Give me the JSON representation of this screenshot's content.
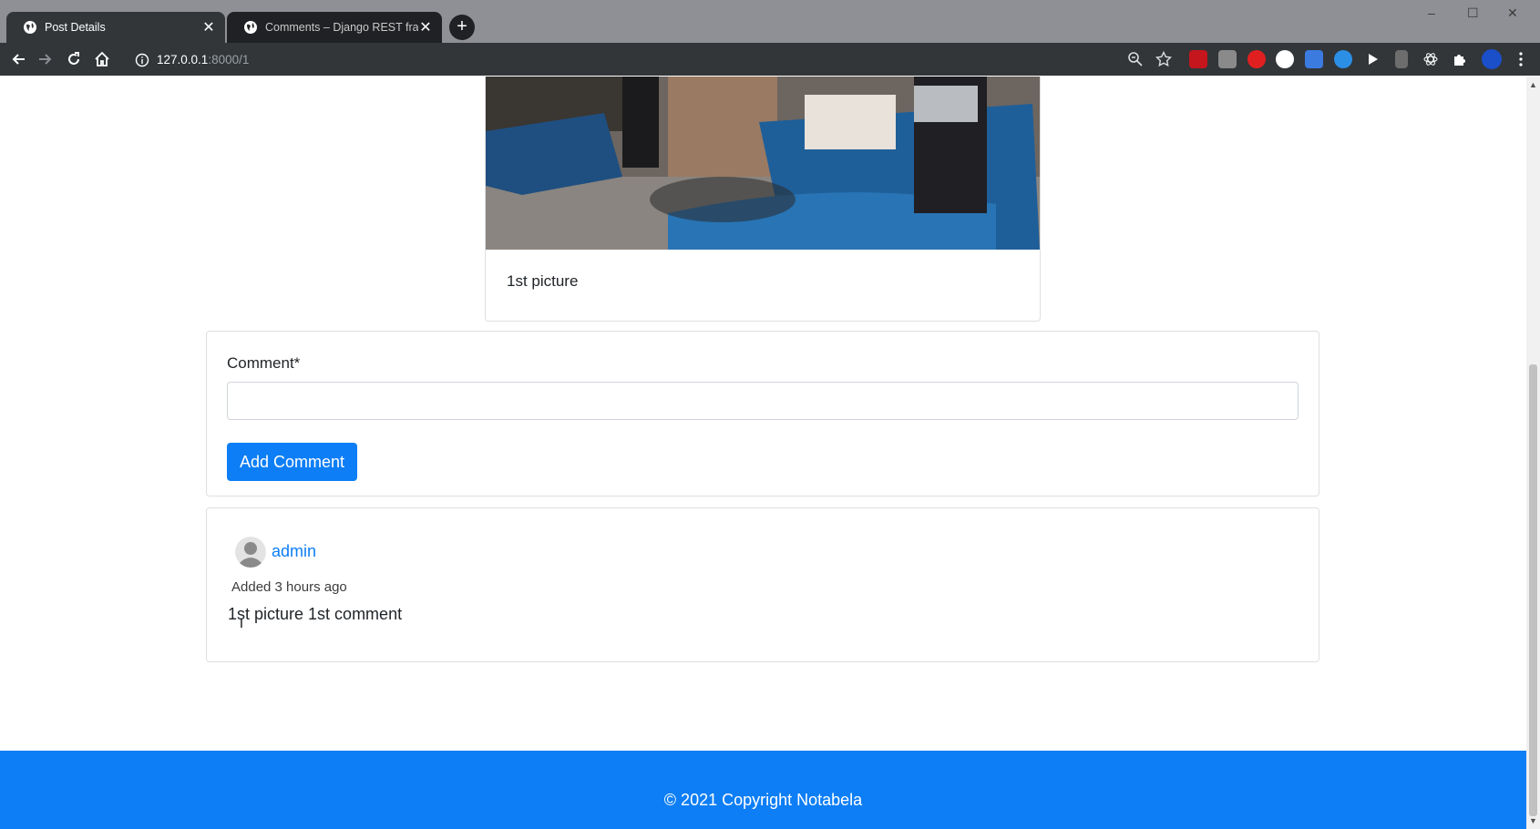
{
  "browser": {
    "tabs": [
      {
        "title": "Post Details",
        "active": true
      },
      {
        "title": "Comments – Django REST frame",
        "active": false
      }
    ],
    "url_host": "127.0.0.1",
    "url_path": ":8000/1",
    "window_controls": [
      "–",
      "☐",
      "✕"
    ],
    "new_tab_label": "+"
  },
  "post": {
    "caption": "1st picture"
  },
  "comment_form": {
    "label": "Comment*",
    "input_value": "",
    "submit_label": "Add Comment"
  },
  "comments": [
    {
      "author": "admin",
      "added": "Added 3 hours ago",
      "text": "1st picture 1st comment"
    }
  ],
  "footer": {
    "text": "© 2021 Copyright Notabela"
  },
  "colors": {
    "primary": "#0d7ef5",
    "chrome_dark": "#323639",
    "tabstrip": "#8f9095"
  }
}
